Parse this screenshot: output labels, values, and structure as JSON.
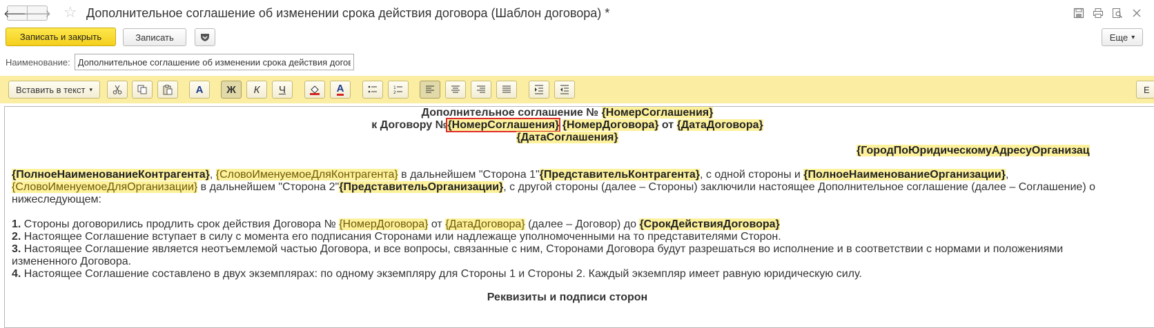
{
  "window": {
    "title": "Дополнительное соглашение об изменении срока действия договора (Шаблон договора) *",
    "icons": [
      "save-icon",
      "print-icon",
      "preview-icon",
      "close-icon"
    ]
  },
  "commands": {
    "write_close": "Записать и закрыть",
    "write": "Записать",
    "more": "Еще",
    "more_arrow": "▾"
  },
  "name_field": {
    "label": "Наименование:",
    "value": "Дополнительное соглашение об изменении срока действия догово"
  },
  "toolbar": {
    "insert_label": "Вставить в текст",
    "insert_arrow": "▾",
    "bold": "Ж",
    "italic": "К",
    "underline": "Ч",
    "font_letter": "A",
    "color_letter": "A",
    "cut_right_label": "Е"
  },
  "document": {
    "heading_prefix": "Дополнительное соглашение № ",
    "field_agreement_num": "{НомерСоглашения}",
    "line2_prefix": "к Договору №",
    "field_agreement_num_2": "{НомерСоглашения}",
    "field_contract_num": "{НомерДоговора}",
    "word_from": " от ",
    "field_contract_date": "{ДатаДоговора}",
    "field_agreement_date": "{ДатаСоглашения}",
    "field_city": "{ГородПоЮридическомуАдресуОрганизац",
    "p1_field_cp_full": "{ПолноеНаименованиеКонтрагента}",
    "p1_field_cp_word": "{СловоИменуемоеДляКонтрагента}",
    "p1_text_1": " в дальнейшем \"Сторона 1\"",
    "p1_field_cp_rep": "{ПредставительКонтрагента}",
    "p1_text_2": ", с одной стороны и ",
    "p1_field_org_full": "{ПолноеНаименованиеОрганизации}",
    "p2_field_org_word": "{СловоИменуемоеДляОрганизации}",
    "p2_text_1": " в дальнейшем \"Сторона 2\"",
    "p2_field_org_rep": "{ПредставительОрганизации}",
    "p2_text_2": ", с другой стороны (далее – Стороны) заключили настоящее Дополнительное соглашение (далее – Соглашение) о",
    "p3_text": "нижеследующем:",
    "i1_num": "1.",
    "i1_text_1": " Стороны договорились продлить срок действия Договора № ",
    "i1_field_num": "{НомерДоговора}",
    "i1_text_2": " от ",
    "i1_field_date": "{ДатаДоговора}",
    "i1_text_3": " (далее – Договор) до ",
    "i1_field_term": "{СрокДействияДоговора}",
    "i2_num": "2.",
    "i2_text": " Настоящее Соглашение вступает в силу с момента его подписания Сторонами или надлежаще уполномоченными на то представителями Сторон.",
    "i3_num": "3.",
    "i3_text": " Настоящее Соглашение является неотъемлемой частью Договора, и все вопросы, связанные с ним, Сторонами Договора будут разрешаться во исполнение и в соответствии с нормами и положениями",
    "i3_cont": "измененного Договора.",
    "i4_num": "4.",
    "i4_text": " Настоящее Соглашение составлено в двух экземплярах: по одному экземпляру для Стороны 1 и Стороны 2. Каждый экземпляр имеет равную юридическую силу.",
    "footer_heading": "Реквизиты и подписи сторон"
  }
}
